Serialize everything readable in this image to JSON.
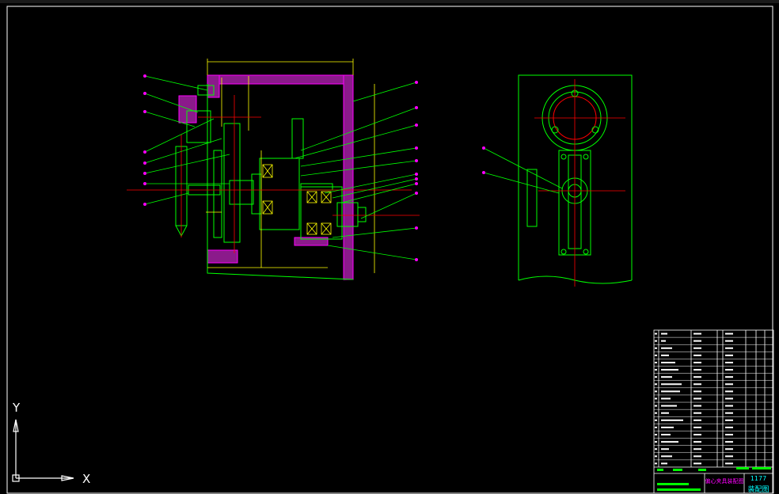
{
  "ucs": {
    "y_label": "Y",
    "x_label": "X"
  },
  "title_block": {
    "drawing_title": "偏心夹具装配图",
    "drawing_no": "1177",
    "sheet_name": "装配图"
  },
  "colors": {
    "background": "#000000",
    "frame": "#ffffff",
    "outline": "#00ff00",
    "section": "#ff00ff",
    "dimension": "#ffff00",
    "center": "#ff0000",
    "leader": "#00ff00",
    "balloon": "#ff00ff",
    "cyan": "#00ffff"
  }
}
